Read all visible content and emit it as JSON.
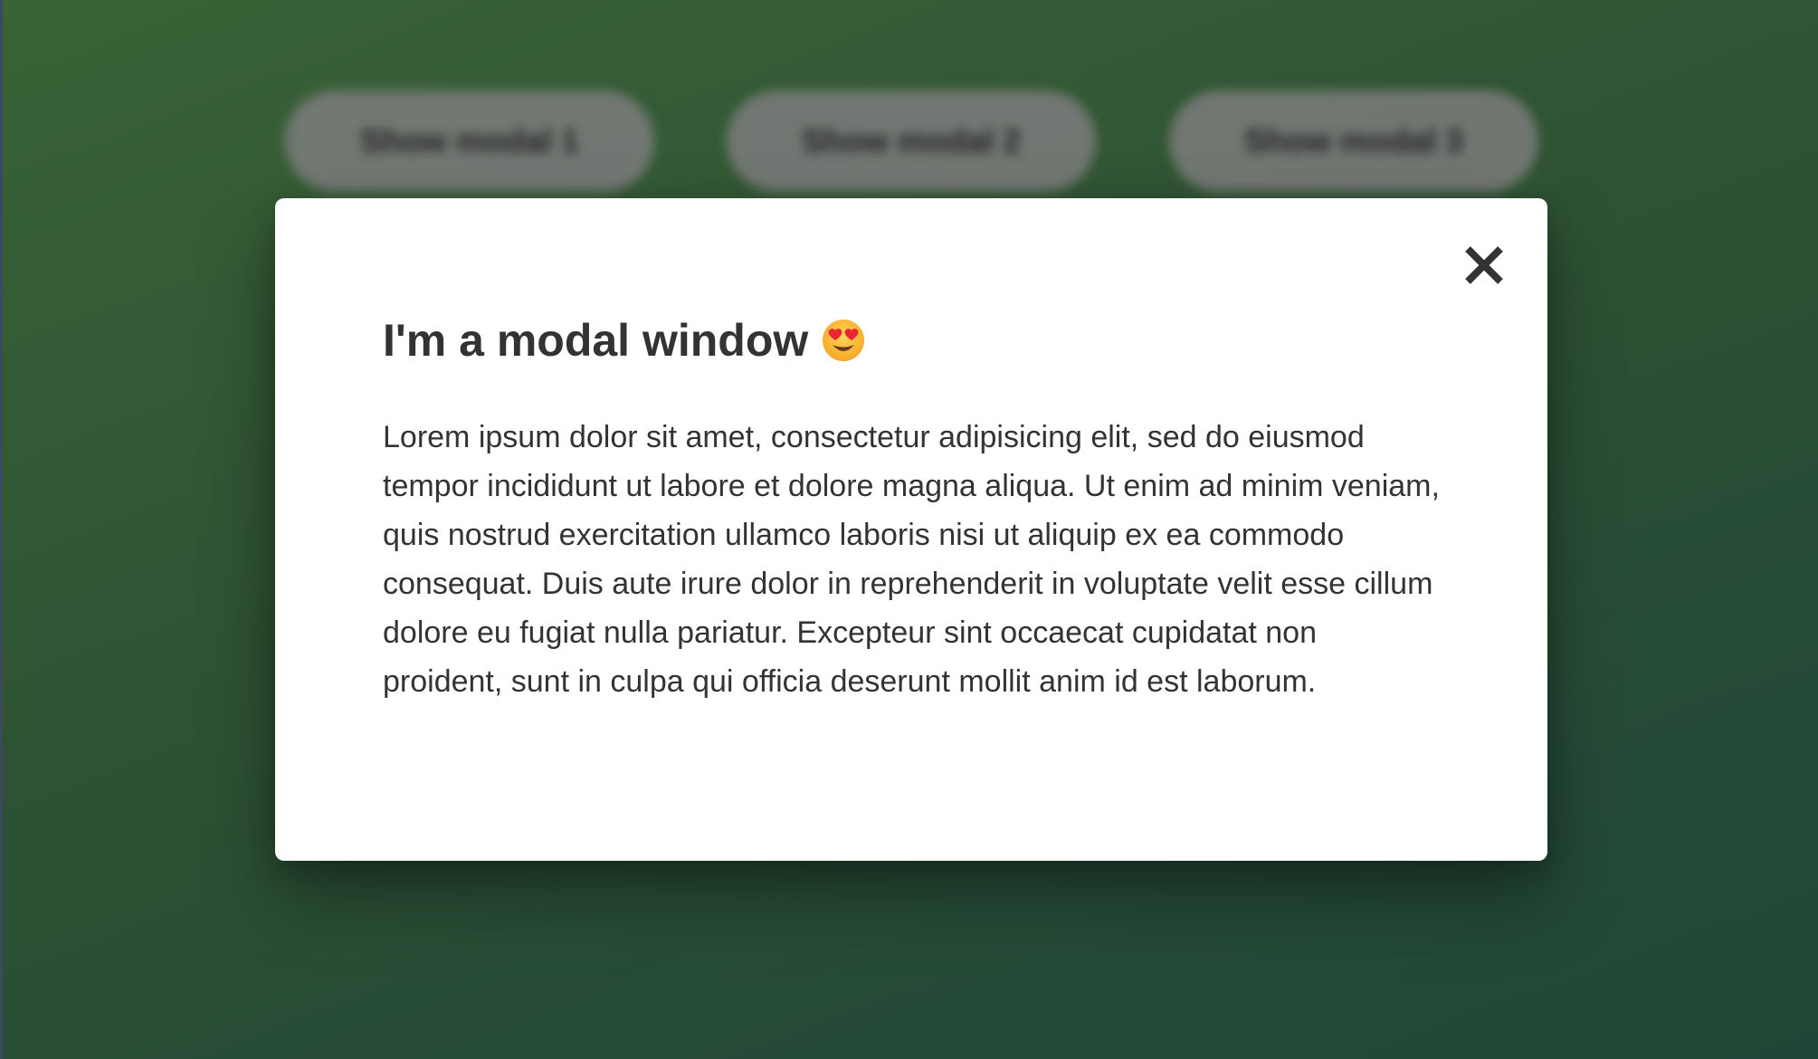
{
  "background_buttons": [
    {
      "label": "Show modal 1"
    },
    {
      "label": "Show modal 2"
    },
    {
      "label": "Show modal 3"
    }
  ],
  "modal": {
    "title": "I'm a modal window",
    "title_emoji": "smiling-face-with-heart-eyes-icon",
    "body": "Lorem ipsum dolor sit amet, consectetur adipisicing elit, sed do eiusmod tempor incididunt ut labore et dolore magna aliqua. Ut enim ad minim veniam, quis nostrud exercitation ullamco laboris nisi ut aliquip ex ea commodo consequat. Duis aute irure dolor in reprehenderit in voluptate velit esse cillum dolore eu fugiat nulla pariatur. Excepteur sint occaecat cupidatat non proident, sunt in culpa qui officia deserunt mollit anim id est laborum.",
    "close_icon": "close-icon"
  },
  "colors": {
    "backdrop": "#2f5436",
    "modal_background": "#ffffff",
    "text": "#333333",
    "button_background": "#7d7d7d"
  }
}
